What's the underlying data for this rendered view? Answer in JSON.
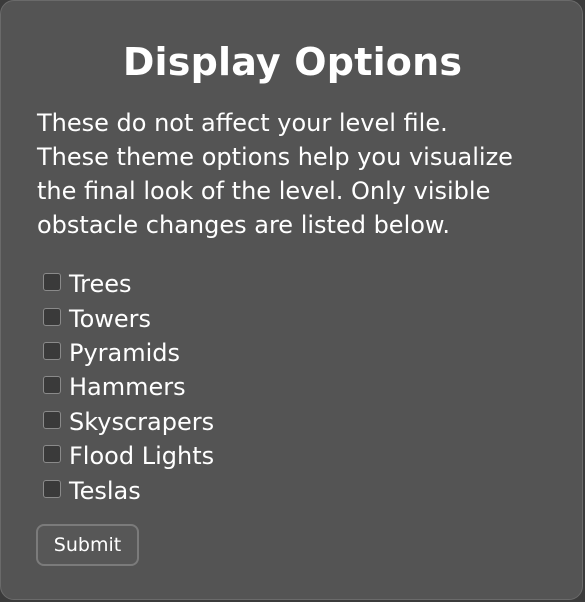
{
  "dialog": {
    "title": "Display Options",
    "description_lines": [
      "These do not affect your level file.",
      "These theme options help you visualize",
      "the final look of the level. Only visible",
      "obstacle changes are listed below."
    ],
    "options": [
      {
        "label": "Trees",
        "checked": false
      },
      {
        "label": "Towers",
        "checked": false
      },
      {
        "label": "Pyramids",
        "checked": false
      },
      {
        "label": "Hammers",
        "checked": false
      },
      {
        "label": "Skyscrapers",
        "checked": false
      },
      {
        "label": "Flood Lights",
        "checked": false
      },
      {
        "label": "Teslas",
        "checked": false
      }
    ],
    "submit_label": "Submit"
  },
  "colors": {
    "panel_background": "#545454",
    "page_background": "#3b3b3b",
    "text": "#ffffff"
  }
}
